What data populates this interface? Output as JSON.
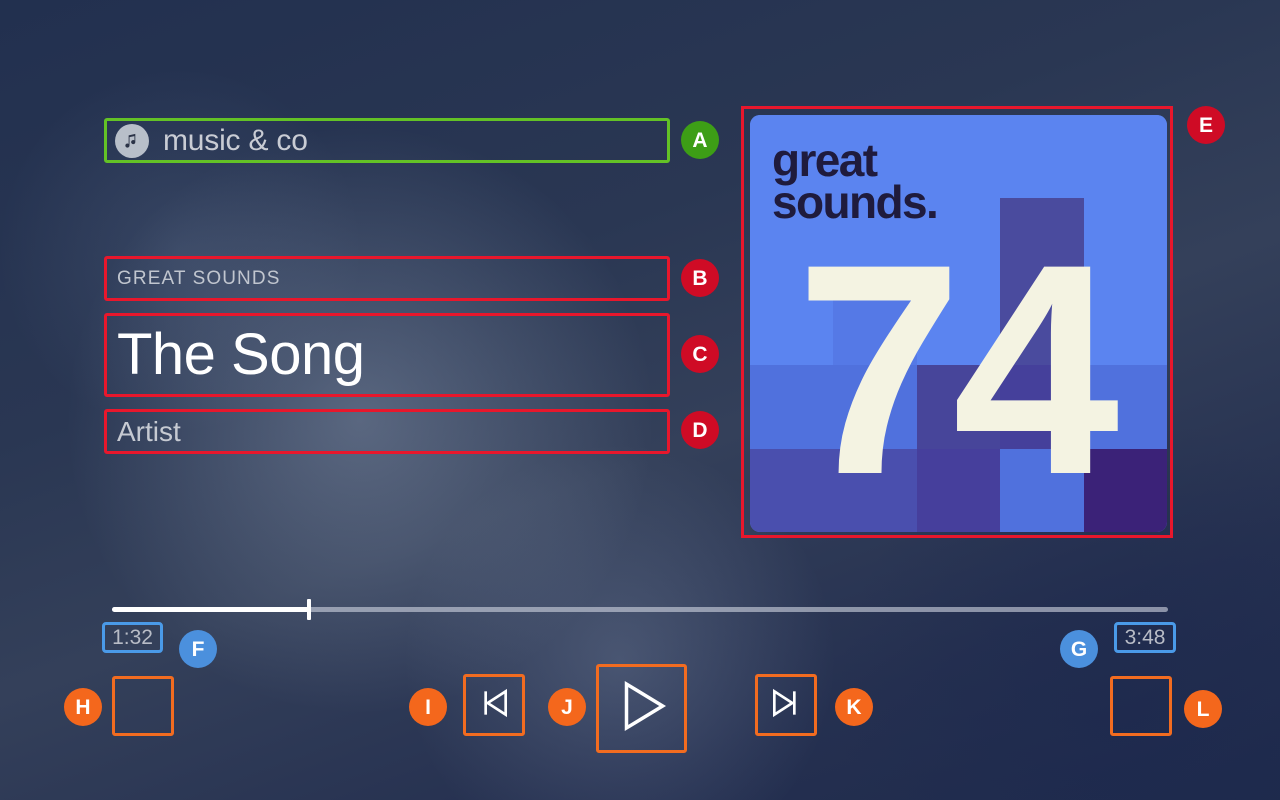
{
  "app": {
    "name": "music & co",
    "avatar_icon": "music-note-icon"
  },
  "now_playing": {
    "album": "GREAT SOUNDS",
    "title": "The Song",
    "artist": "Artist"
  },
  "album_art": {
    "brand_line1": "great",
    "brand_line2": "sounds.",
    "number": "74"
  },
  "progress": {
    "current_time": "1:32",
    "total_time": "3:48",
    "percent": 18.7
  },
  "controls": {
    "shuffle": "",
    "previous": "previous-track",
    "play": "play",
    "next": "next-track",
    "repeat": ""
  },
  "annotations": [
    {
      "id": "A",
      "color": "#3d9e16",
      "target": "app-title"
    },
    {
      "id": "B",
      "color": "#cf0b25",
      "target": "album-name"
    },
    {
      "id": "C",
      "color": "#cf0b25",
      "target": "song-title"
    },
    {
      "id": "D",
      "color": "#cf0b25",
      "target": "artist-name"
    },
    {
      "id": "E",
      "color": "#cf0b25",
      "target": "album-art"
    },
    {
      "id": "F",
      "color": "#4b90dd",
      "target": "current-time"
    },
    {
      "id": "G",
      "color": "#4b90dd",
      "target": "total-time"
    },
    {
      "id": "H",
      "color": "#f4671c",
      "target": "shuffle-button"
    },
    {
      "id": "I",
      "color": "#f4671c",
      "target": "previous-button"
    },
    {
      "id": "J",
      "color": "#f4671c",
      "target": "play-button"
    },
    {
      "id": "K",
      "color": "#f4671c",
      "target": "next-button"
    },
    {
      "id": "L",
      "color": "#f4671c",
      "target": "repeat-button"
    }
  ],
  "colors": {
    "accent_green": "#63c226",
    "accent_red": "#e8172c",
    "accent_blue": "#4a9ae8",
    "accent_orange": "#f26c20",
    "art_blue": "#5b84f0",
    "art_cream": "#f4f3e2",
    "art_ink": "#1f1b3d"
  }
}
